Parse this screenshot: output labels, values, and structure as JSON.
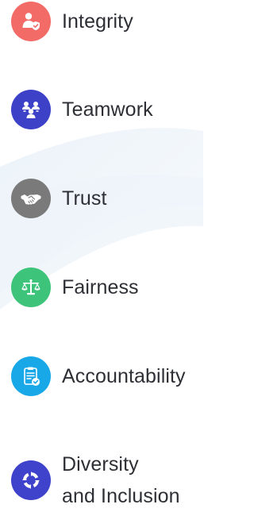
{
  "colors": {
    "integrity": "#f26b67",
    "teamwork": "#3d41c8",
    "trust": "#7a7a7a",
    "fairness": "#3ec47a",
    "accountability": "#18a8e8",
    "diversity": "#3f42ca",
    "text": "#2d2f35",
    "background": "#ffffff"
  },
  "values": [
    {
      "label": "Integrity",
      "icon": "user-shield-icon"
    },
    {
      "label": "Teamwork",
      "icon": "team-icon"
    },
    {
      "label": "Trust",
      "icon": "handshake-icon"
    },
    {
      "label": "Fairness",
      "icon": "scales-icon"
    },
    {
      "label": "Accountability",
      "icon": "clipboard-check-icon"
    },
    {
      "label_line1": "Diversity",
      "label_line2": "and Inclusion",
      "icon": "circle-arrows-icon"
    }
  ]
}
